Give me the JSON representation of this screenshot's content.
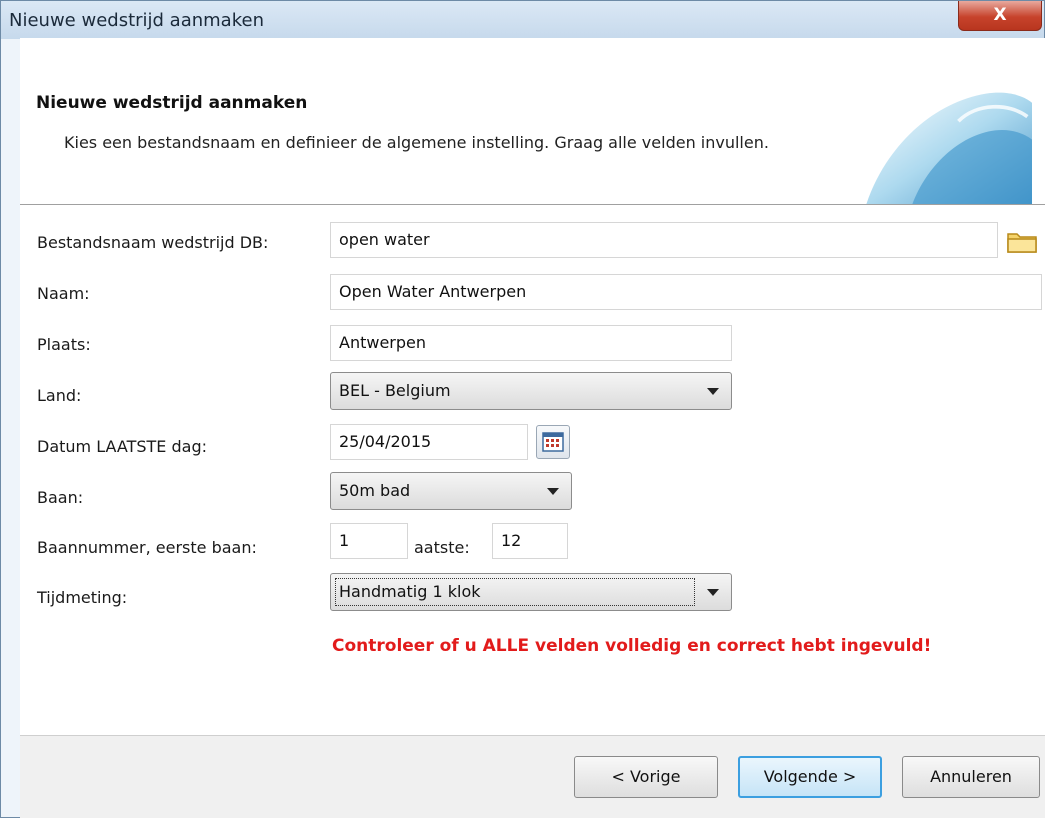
{
  "window": {
    "title": "Nieuwe wedstrijd aanmaken",
    "close_glyph": "X"
  },
  "header": {
    "title": "Nieuwe wedstrijd aanmaken",
    "description": "Kies een bestandsnaam en definieer de algemene instelling. Graag alle velden invullen."
  },
  "form": {
    "filename": {
      "label": "Bestandsnaam wedstrijd DB:",
      "value": "open water",
      "browse_icon": "folder-icon"
    },
    "name": {
      "label": "Naam:",
      "value": "Open Water Antwerpen"
    },
    "place": {
      "label": "Plaats:",
      "value": "Antwerpen"
    },
    "country": {
      "label": "Land:",
      "value": "BEL - Belgium"
    },
    "date": {
      "label": "Datum LAATSTE dag:",
      "value": "25/04/2015",
      "picker_icon": "calendar-icon"
    },
    "pool": {
      "label": "Baan:",
      "value": "50m bad"
    },
    "lanes": {
      "label": "Baannummer, eerste baan:",
      "first": "1",
      "last_label": "aatste:",
      "last": "12"
    },
    "timing": {
      "label": "Tijdmeting:",
      "value": "Handmatig 1 klok"
    }
  },
  "warning": "Controleer of u ALLE velden volledig en correct hebt ingevuld!",
  "buttons": {
    "back": "< Vorige",
    "next": "Volgende >",
    "cancel": "Annuleren"
  },
  "colors": {
    "warning": "#e21b1b",
    "default_button_border": "#3c9fe0"
  }
}
